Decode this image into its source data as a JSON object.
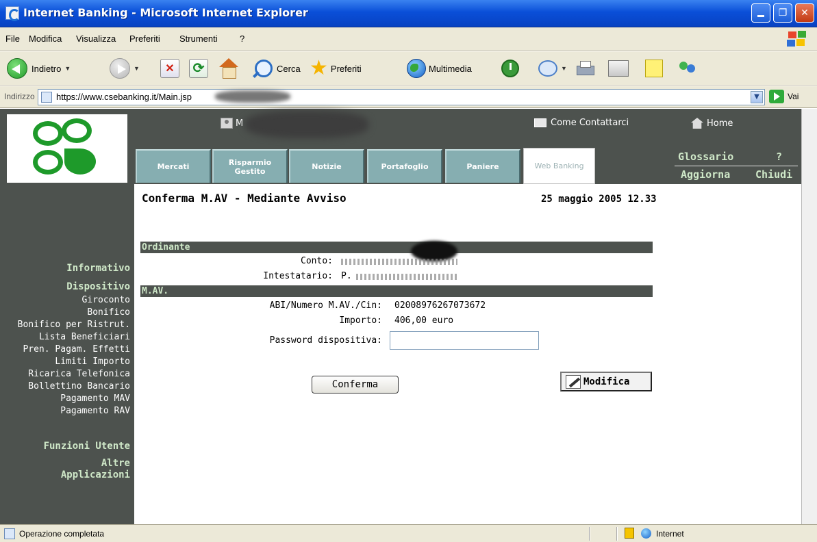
{
  "window": {
    "title": "Internet Banking - Microsoft Internet Explorer"
  },
  "menu": [
    "File",
    "Modifica",
    "Visualizza",
    "Preferiti",
    "Strumenti",
    "?"
  ],
  "toolbar": {
    "back": "Indietro",
    "search": "Cerca",
    "favorites": "Preferiti",
    "media": "Multimedia"
  },
  "address": {
    "label": "Indirizzo",
    "url": "https://www.csebanking.it/Main.jsp",
    "go": "Vai"
  },
  "header": {
    "user_initial": "M",
    "contact": "Come Contattarci",
    "home": "Home",
    "glossary": "Glossario",
    "help": "?",
    "refresh": "Aggiorna",
    "close": "Chiudi"
  },
  "tabs": [
    {
      "label": "Mercati"
    },
    {
      "label": "Risparmio Gestito"
    },
    {
      "label": "Notizie"
    },
    {
      "label": "Portafoglio"
    },
    {
      "label": "Paniere"
    },
    {
      "label": "Web Banking"
    }
  ],
  "page": {
    "title": "Conferma M.AV - Mediante Avviso",
    "datetime": "25 maggio 2005 12.33"
  },
  "ordinante": {
    "section": "Ordinante",
    "conto_label": "Conto:",
    "intestatario_label": "Intestatario:",
    "intestatario_value": "P."
  },
  "mav": {
    "section": "M.AV.",
    "abi_label": "ABI/Numero M.AV./Cin:",
    "abi_value": "02008976267073672",
    "importo_label": "Importo:",
    "importo_value": "406,00 euro",
    "password_label": "Password dispositiva:",
    "password_value": ""
  },
  "buttons": {
    "confirm": "Conferma",
    "modify": "Modifica"
  },
  "sidebar": {
    "informativo": "Informativo",
    "dispositivo": "Dispositivo",
    "items": [
      "Giroconto",
      "Bonifico",
      "Bonifico per Ristrut.",
      "Lista Beneficiari",
      "Pren. Pagam. Effetti",
      "Limiti Importo",
      "Ricarica Telefonica",
      "Bollettino Bancario",
      "Pagamento MAV",
      "Pagamento RAV"
    ],
    "funzioni": "Funzioni Utente",
    "altre_1": "Altre",
    "altre_2": "Applicazioni"
  },
  "status": {
    "text": "Operazione completata",
    "zone": "Internet"
  },
  "colors": {
    "titlebar": "#0a4fd8",
    "chrome": "#ece9d8",
    "bank_dark": "#4d524e",
    "bank_green_text": "#cfe8c8",
    "tab_teal": "#86aeb1",
    "logo_green": "#1e9a2a"
  }
}
